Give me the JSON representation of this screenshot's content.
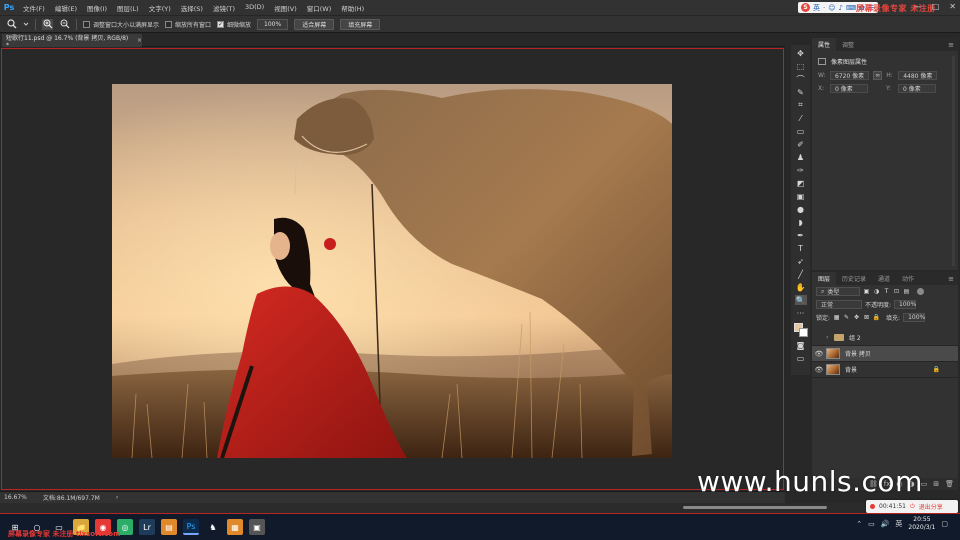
{
  "app": {
    "logo": "Ps",
    "menus": [
      "文件(F)",
      "编辑(E)",
      "图像(I)",
      "图层(L)",
      "文字(Y)",
      "选择(S)",
      "滤镜(T)",
      "3D(D)",
      "视图(V)",
      "窗口(W)",
      "帮助(H)"
    ],
    "window_controls": [
      "—",
      "□",
      "✕"
    ]
  },
  "ime": {
    "logo": "S",
    "lang": "英",
    "icons": [
      "·",
      "☺",
      "♪",
      "⌨",
      "✿",
      "☰"
    ]
  },
  "watermark_top": "屏幕录像专家 未注册",
  "options": {
    "tool_icon": "zoom-tool-icon",
    "checkboxes": [
      {
        "label": "调整窗口大小以满屏显示",
        "checked": false
      },
      {
        "label": "缩放所有窗口",
        "checked": false
      },
      {
        "label": "细微缩放",
        "checked": true
      }
    ],
    "zoom_value": "100%",
    "fit_screen": "适合屏幕",
    "fill_screen": "填充屏幕"
  },
  "document": {
    "tab_title": "短歌行11.psd @ 16.7% (背景 拷贝, RGB/8) *",
    "zoom": "16.67%",
    "doc_info": "文档:86.1M/697.7M"
  },
  "tools": [
    {
      "name": "move-tool-icon",
      "glyph": "✥"
    },
    {
      "name": "marquee-tool-icon",
      "glyph": "⬚"
    },
    {
      "name": "lasso-tool-icon",
      "glyph": "⌒"
    },
    {
      "name": "quick-select-tool-icon",
      "glyph": "✎"
    },
    {
      "name": "crop-tool-icon",
      "glyph": "⌗"
    },
    {
      "name": "eyedropper-tool-icon",
      "glyph": "⁄"
    },
    {
      "name": "spot-heal-tool-icon",
      "glyph": "▭"
    },
    {
      "name": "brush-tool-icon",
      "glyph": "✐"
    },
    {
      "name": "stamp-tool-icon",
      "glyph": "♟"
    },
    {
      "name": "history-brush-icon",
      "glyph": "✑"
    },
    {
      "name": "eraser-tool-icon",
      "glyph": "◩"
    },
    {
      "name": "gradient-tool-icon",
      "glyph": "▣"
    },
    {
      "name": "blur-tool-icon",
      "glyph": "●"
    },
    {
      "name": "dodge-tool-icon",
      "glyph": "◗"
    },
    {
      "name": "pen-tool-icon",
      "glyph": "✒"
    },
    {
      "name": "type-tool-icon",
      "glyph": "T"
    },
    {
      "name": "path-select-tool-icon",
      "glyph": "➶"
    },
    {
      "name": "line-tool-icon",
      "glyph": "╱"
    },
    {
      "name": "hand-tool-icon",
      "glyph": "✋"
    },
    {
      "name": "zoom-tool-icon",
      "glyph": "🔍"
    },
    {
      "name": "more-tools-icon",
      "glyph": "···"
    }
  ],
  "properties": {
    "tabs": [
      "属性",
      "调整"
    ],
    "subtitle": "像素图层属性",
    "w_label": "W:",
    "w_value": "6720 像素",
    "h_label": "H:",
    "h_value": "4480 像素",
    "x_label": "X:",
    "x_value": "0 像素",
    "y_label": "Y:",
    "y_value": "0 像素"
  },
  "layers": {
    "tabs": [
      "图层",
      "历史记录",
      "通道",
      "动作"
    ],
    "filter_type": "类型",
    "blend_mode": "正常",
    "opacity_label": "不透明度:",
    "opacity": "100%",
    "lock_label": "锁定:",
    "fill_label": "填充:",
    "fill": "100%",
    "items": [
      {
        "name": "组 2",
        "kind": "group",
        "visible": false,
        "selected": false
      },
      {
        "name": "背景 拷贝",
        "kind": "pixel",
        "visible": true,
        "selected": true
      },
      {
        "name": "背景",
        "kind": "pixel",
        "visible": true,
        "selected": false,
        "locked": true
      }
    ],
    "footer_icons": [
      "⛓",
      "fx",
      "◐",
      "◑",
      "▭",
      "⊞",
      "🗑"
    ]
  },
  "overlay": {
    "site": "www.hunls.com",
    "timer": "00:41:51",
    "exit_share": "退出分享"
  },
  "watermark_bottom": "屏幕录像专家 未注册 tlxsoft.com",
  "taskbar": {
    "apps": [
      "⊞",
      "○",
      "▭",
      "📁",
      "◉",
      "◎",
      "Lr",
      "▤",
      "Ps",
      "♞",
      "▦",
      "▣"
    ],
    "tray_lang": "英",
    "time": "20:55",
    "date": "2020/3/1"
  }
}
